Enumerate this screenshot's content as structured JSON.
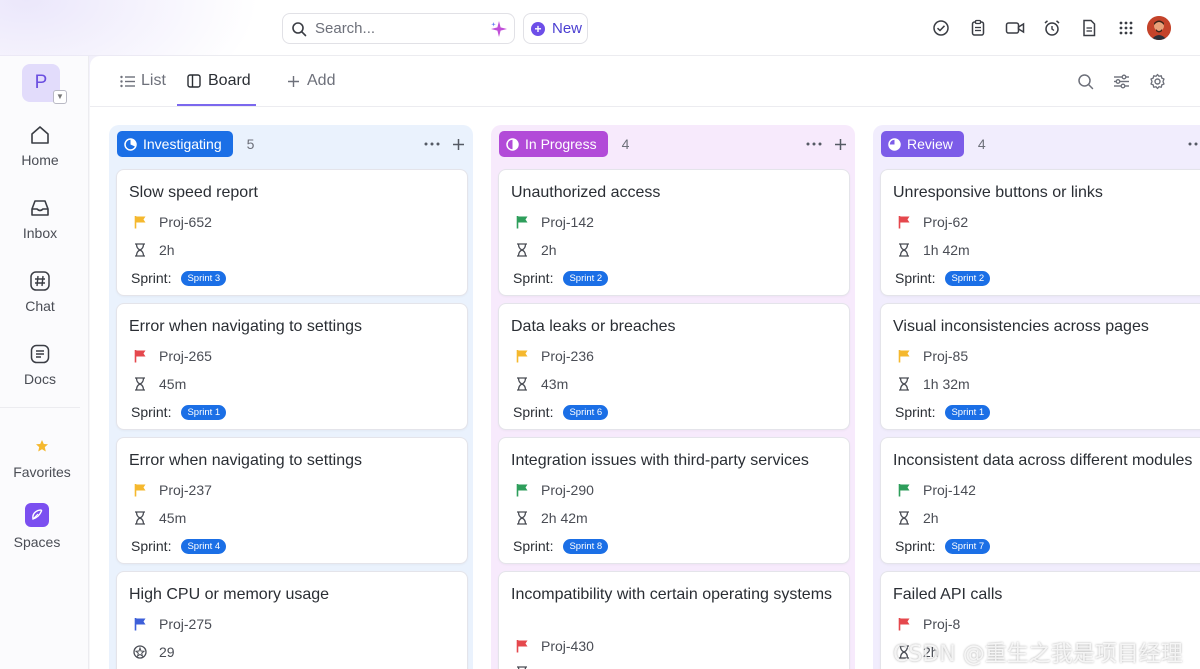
{
  "topbar": {
    "search_placeholder": "Search...",
    "new_label": "New",
    "icons": [
      "check-circle-icon",
      "clipboard-icon",
      "video-icon",
      "alarm-icon",
      "document-icon",
      "apps-grid-icon"
    ],
    "accent": "#7b68ee"
  },
  "sidebar": {
    "workspace_initial": "P",
    "items": [
      {
        "label": "Home",
        "icon": "home-icon"
      },
      {
        "label": "Inbox",
        "icon": "inbox-icon"
      },
      {
        "label": "Chat",
        "icon": "hash-icon"
      },
      {
        "label": "Docs",
        "icon": "docs-icon"
      },
      {
        "label": "Favorites",
        "icon": "star-icon"
      },
      {
        "label": "Spaces",
        "icon": "spaces-icon"
      }
    ]
  },
  "views": {
    "tabs": [
      {
        "label": "List",
        "icon": "list-icon"
      },
      {
        "label": "Board",
        "icon": "board-icon",
        "active": true
      },
      {
        "label": "Add",
        "icon": "plus-icon"
      }
    ],
    "tools": [
      "search-icon",
      "filter-icon",
      "settings-icon"
    ]
  },
  "board": {
    "sprint_label": "Sprint:",
    "columns": [
      {
        "status": "Investigating",
        "count": "5",
        "color": "#1b6fe6",
        "bg": "#eaf2fd",
        "cards": [
          {
            "title": "Slow speed report",
            "id": "Proj-652",
            "flag": "#f5b82e",
            "estimate": "2h",
            "sprint": "Sprint 3"
          },
          {
            "title": "Error when navigating to settings",
            "id": "Proj-265",
            "flag": "#e5484d",
            "estimate": "45m",
            "sprint": "Sprint 1"
          },
          {
            "title": "Error when navigating to settings",
            "id": "Proj-237",
            "flag": "#f5b82e",
            "estimate": "45m",
            "sprint": "Sprint 4"
          },
          {
            "title": "High CPU or memory usage",
            "id": "Proj-275",
            "flag": "#3d5fd9",
            "estimate": "29"
          }
        ]
      },
      {
        "status": "In Progress",
        "count": "4",
        "color": "#b24bd8",
        "bg": "#f7eafc",
        "cards": [
          {
            "title": "Unauthorized access",
            "id": "Proj-142",
            "flag": "#2e9e5b",
            "estimate": "2h",
            "sprint": "Sprint 2"
          },
          {
            "title": "Data leaks or breaches",
            "id": "Proj-236",
            "flag": "#f5b82e",
            "estimate": "43m",
            "sprint": "Sprint 6"
          },
          {
            "title": "Integration issues with third-party services",
            "id": "Proj-290",
            "flag": "#2e9e5b",
            "estimate": "2h 42m",
            "sprint": "Sprint 8"
          },
          {
            "title": "Incompatibility with certain operating systems",
            "id": "Proj-430",
            "flag": "#e5484d",
            "estimate": ""
          }
        ]
      },
      {
        "status": "Review",
        "count": "4",
        "color": "#7c5ce8",
        "bg": "#f1edfd",
        "cards": [
          {
            "title": "Unresponsive buttons or links",
            "id": "Proj-62",
            "flag": "#e5484d",
            "estimate": "1h 42m",
            "sprint": "Sprint 2"
          },
          {
            "title": "Visual inconsistencies across pages",
            "id": "Proj-85",
            "flag": "#f5b82e",
            "estimate": "1h 32m",
            "sprint": "Sprint 1"
          },
          {
            "title": "Inconsistent data across different modules",
            "id": "Proj-142",
            "flag": "#2e9e5b",
            "estimate": "2h",
            "sprint": "Sprint 7"
          },
          {
            "title": "Failed API calls",
            "id": "Proj-8",
            "flag": "#e5484d",
            "estimate": "2h"
          }
        ]
      }
    ]
  },
  "watermark": "CSDN @重生之我是项目经理"
}
